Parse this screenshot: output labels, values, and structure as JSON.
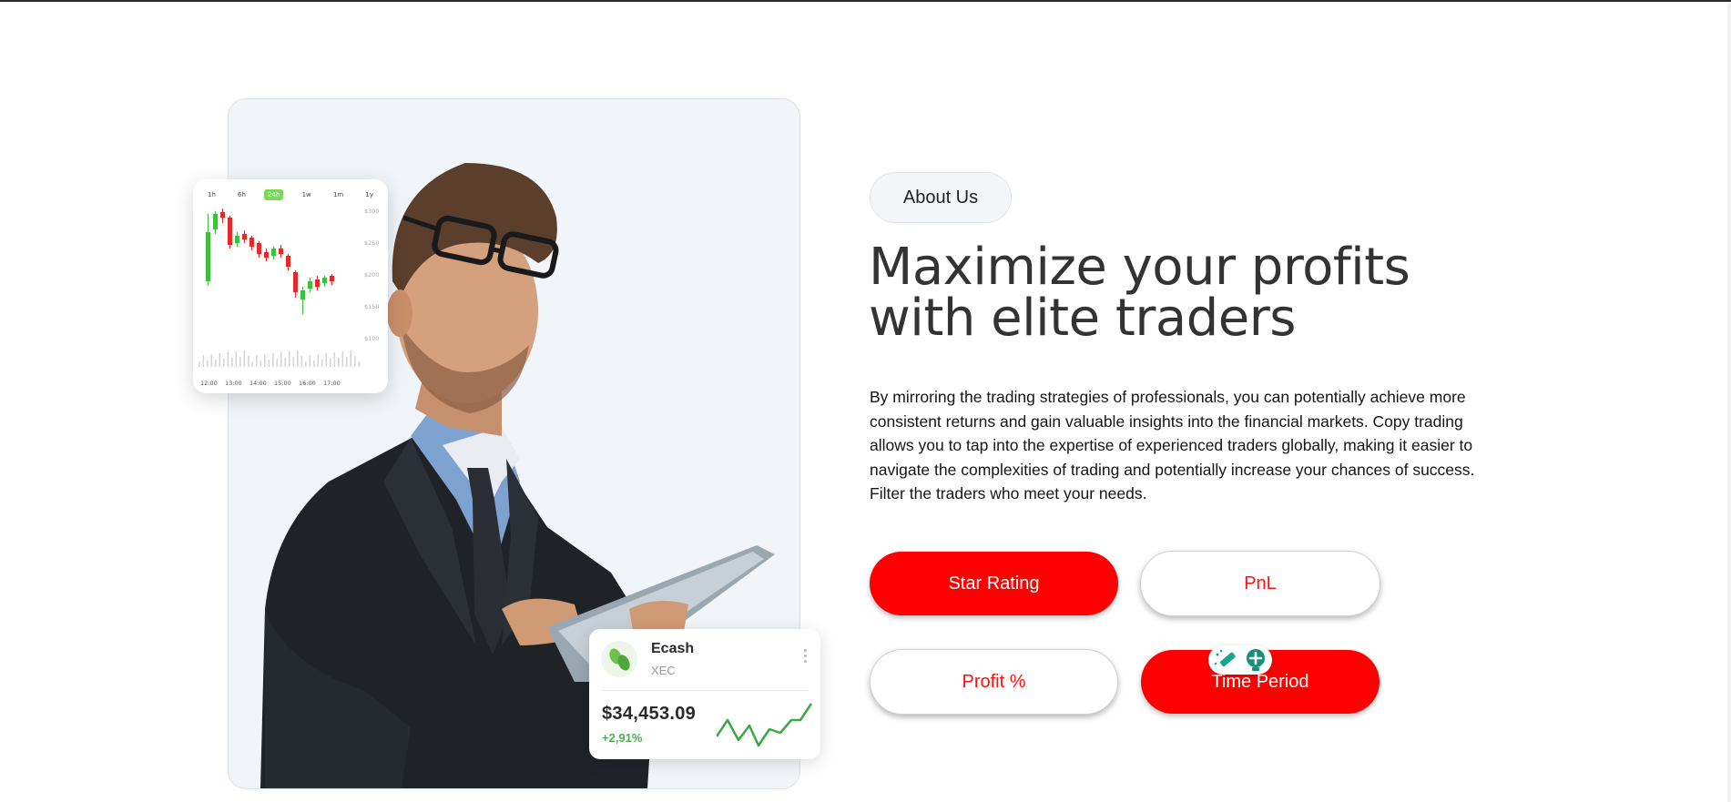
{
  "chart_widget": {
    "timeframes": [
      "1h",
      "6h",
      "24h",
      "1w",
      "1m",
      "1y"
    ],
    "active_timeframe": "24h",
    "price_ticks": [
      "$300",
      "$250",
      "$200",
      "$150",
      "$100"
    ],
    "time_ticks": [
      "12:00",
      "13:00",
      "14:00",
      "15:00",
      "16:00",
      "17:00"
    ]
  },
  "coin_card": {
    "name": "Ecash",
    "symbol": "XEC",
    "price": "$34,453.09",
    "change": "+2,91%",
    "change_color": "#4caf50"
  },
  "about": {
    "pill_label": "About Us",
    "headline_line1": "Maximize your profits",
    "headline_line2": "with elite traders",
    "paragraph": "By mirroring the trading strategies of professionals, you can potentially achieve more consistent returns and gain valuable insights into the financial markets. Copy trading allows you to tap into the expertise of experienced traders globally, making it easier to navigate the complexities of trading and potentially increase your chances of success. Filter the traders who meet your needs."
  },
  "filters": {
    "star_rating": "Star Rating",
    "pnl": "PnL",
    "profit_pct": "Profit %",
    "time_period": "Time Period"
  },
  "colors": {
    "accent": "#ff0000",
    "chart_up": "#3cbf3c",
    "chart_down": "#e22a2a"
  },
  "icons": {
    "extension_1": "magic-wand-icon",
    "extension_2": "lightbulb-icon"
  }
}
